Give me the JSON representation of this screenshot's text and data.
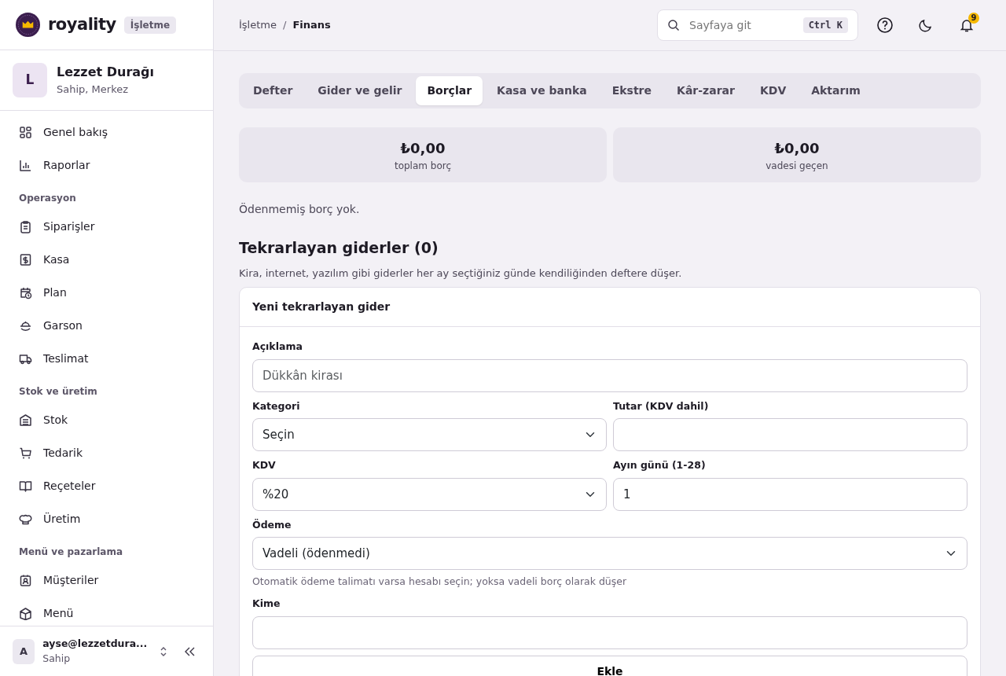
{
  "brand": {
    "name": "royality",
    "badge": "İşletme"
  },
  "business": {
    "initial": "L",
    "name": "Lezzet Durağı",
    "role": "Sahip, Merkez"
  },
  "sidebar": {
    "items": [
      {
        "kind": "link",
        "label": "Genel bakış"
      },
      {
        "kind": "link",
        "label": "Raporlar"
      },
      {
        "kind": "section",
        "label": "Operasyon"
      },
      {
        "kind": "link",
        "label": "Siparişler"
      },
      {
        "kind": "link",
        "label": "Kasa"
      },
      {
        "kind": "link",
        "label": "Plan"
      },
      {
        "kind": "link",
        "label": "Garson"
      },
      {
        "kind": "link",
        "label": "Teslimat"
      },
      {
        "kind": "section",
        "label": "Stok ve üretim"
      },
      {
        "kind": "link",
        "label": "Stok"
      },
      {
        "kind": "link",
        "label": "Tedarik"
      },
      {
        "kind": "link",
        "label": "Reçeteler"
      },
      {
        "kind": "link",
        "label": "Üretim"
      },
      {
        "kind": "section",
        "label": "Menü ve pazarlama"
      },
      {
        "kind": "link",
        "label": "Müşteriler"
      },
      {
        "kind": "link",
        "label": "Menü"
      }
    ]
  },
  "user": {
    "initial": "A",
    "email": "ayse@lezzetdura...",
    "role": "Sahip"
  },
  "breadcrumb": {
    "separator": "/",
    "items": [
      {
        "label": "İşletme",
        "current": false
      },
      {
        "label": "Finans",
        "current": true
      }
    ]
  },
  "search": {
    "placeholder": "Sayfaya git",
    "shortcut": "Ctrl K"
  },
  "notifications": {
    "count": "9"
  },
  "tabs": [
    {
      "label": "Defter",
      "selected": false
    },
    {
      "label": "Gider ve gelir",
      "selected": false
    },
    {
      "label": "Borçlar",
      "selected": true
    },
    {
      "label": "Kasa ve banka",
      "selected": false
    },
    {
      "label": "Ekstre",
      "selected": false
    },
    {
      "label": "Kâr-zarar",
      "selected": false
    },
    {
      "label": "KDV",
      "selected": false
    },
    {
      "label": "Aktarım",
      "selected": false
    }
  ],
  "stats": [
    {
      "value": "₺0,00",
      "label": "toplam borç"
    },
    {
      "value": "₺0,00",
      "label": "vadesi geçen"
    }
  ],
  "empty_note": "Ödenmemiş borç yok.",
  "recurring": {
    "title": "Tekrarlayan giderler (0)",
    "description": "Kira, internet, yazılım gibi giderler her ay seçtiğiniz günde kendiliğinden deftere düşer.",
    "form_title": "Yeni tekrarlayan gider",
    "field_rows": [
      [
        {
          "kind": "text",
          "label": "Açıklama",
          "placeholder": "Dükkân kirası"
        }
      ],
      [
        {
          "kind": "select",
          "label": "Kategori",
          "value": "Seçin"
        },
        {
          "kind": "text",
          "label": "Tutar (KDV dahil)"
        }
      ],
      [
        {
          "kind": "select",
          "label": "KDV",
          "value": "%20"
        },
        {
          "kind": "text",
          "label": "Ayın günü (1-28)",
          "value": "1"
        }
      ],
      [
        {
          "kind": "select",
          "label": "Ödeme",
          "value": "Vadeli (ödenmedi)",
          "hint": "Otomatik ödeme talimatı varsa hesabı seçin; yoksa vadeli borç olarak düşer"
        }
      ],
      [
        {
          "kind": "text",
          "label": "Kime"
        }
      ]
    ],
    "submit": "Ekle"
  }
}
